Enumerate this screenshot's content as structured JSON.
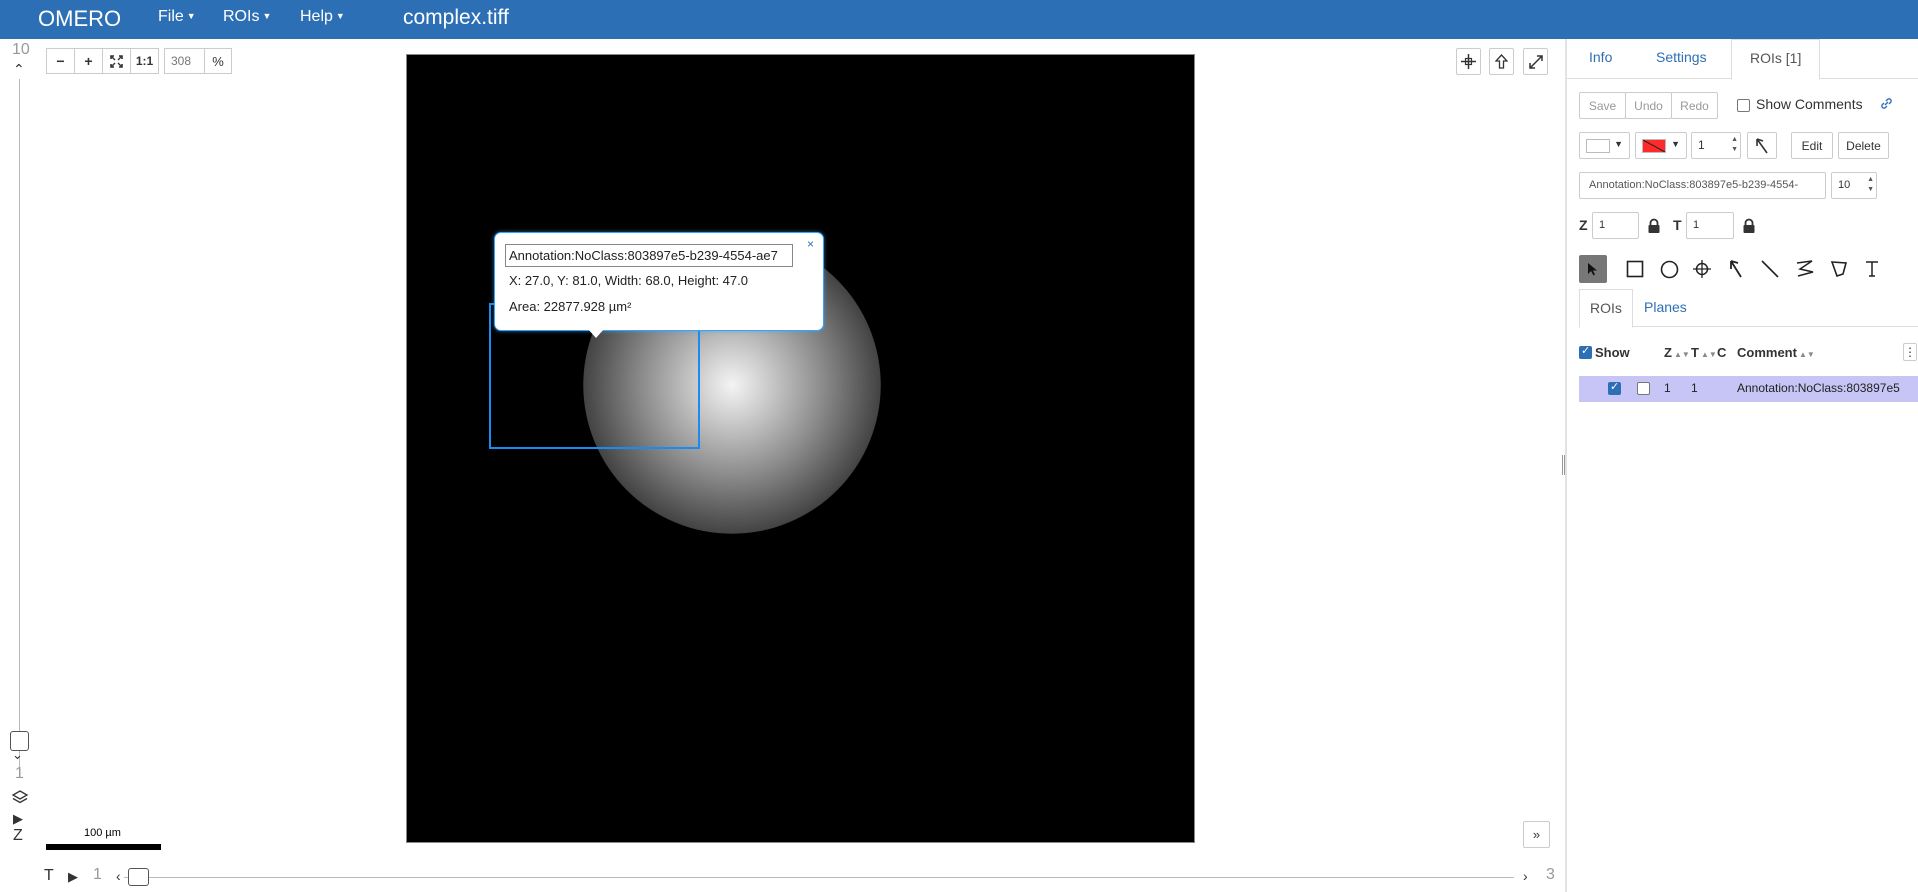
{
  "app": {
    "brand": "OMERO",
    "title": "complex.tiff",
    "menus": [
      {
        "label": "File"
      },
      {
        "label": "ROIs"
      },
      {
        "label": "Help"
      }
    ]
  },
  "viewer": {
    "z_slider": {
      "top_label": "10",
      "bottom_label": "1",
      "axis_label": "Z"
    },
    "zoom": {
      "out_label": "−",
      "in_label": "+",
      "one_to_one": "1:1",
      "value": "308",
      "unit": "%"
    },
    "scalebar": {
      "label": "100 µm"
    },
    "t_slider": {
      "axis_label": "T",
      "start_label": "1",
      "end_label": "3"
    },
    "expand_label": "»",
    "roi_popup": {
      "comment_value": "Annotation:NoClass:803897e5-b239-4554-ae7",
      "close_label": "×",
      "geometry_text": "X: 27.0, Y: 81.0, Width: 68.0, Height: 47.0",
      "area_text": "Area: 22877.928 µm²"
    }
  },
  "panel": {
    "tabs": [
      {
        "label": "Info"
      },
      {
        "label": "Settings"
      },
      {
        "label": "ROIs [1]"
      }
    ],
    "edit_toolbar": {
      "save": "Save",
      "undo": "Undo",
      "redo": "Redo",
      "show_comments": "Show Comments"
    },
    "style_toolbar": {
      "fill_color": "#ffffff",
      "stroke_color": "#ff2a2a",
      "stroke_width": "1",
      "edit": "Edit",
      "delete": "Delete"
    },
    "comment": {
      "value": "Annotation:NoClass:803897e5-b239-4554-",
      "font_size": "10"
    },
    "plane": {
      "z_label": "Z",
      "z_value": "1",
      "t_label": "T",
      "t_value": "1"
    },
    "shape_tools": [
      "select",
      "rectangle",
      "ellipse",
      "point",
      "arrow",
      "line",
      "polyline",
      "polygon",
      "label"
    ],
    "subtabs": [
      {
        "label": "ROIs"
      },
      {
        "label": "Planes"
      }
    ],
    "table": {
      "headers": {
        "show": "Show",
        "z": "Z",
        "t": "T",
        "c": "C",
        "comment": "Comment"
      },
      "rows": [
        {
          "show": true,
          "selected": false,
          "z": "1",
          "t": "1",
          "c": "",
          "comment": "Annotation:NoClass:803897e5"
        }
      ]
    }
  }
}
